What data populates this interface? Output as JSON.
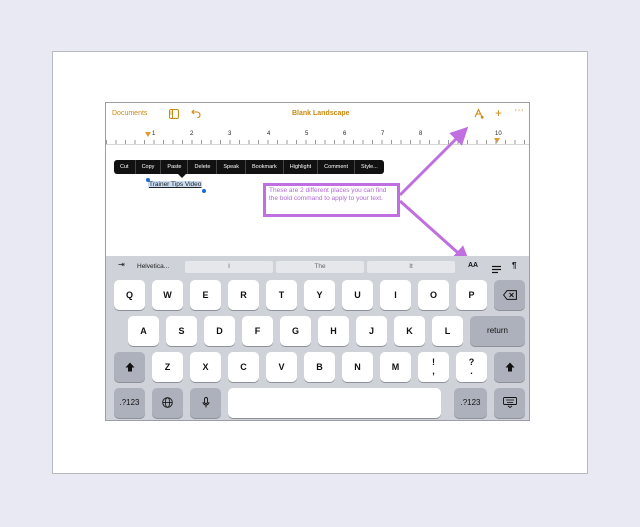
{
  "toolbar": {
    "documents": "Documents",
    "title": "Blank Landscape",
    "more": "⋯"
  },
  "ruler": {
    "labels": [
      "1",
      "2",
      "3",
      "4",
      "5",
      "6",
      "7",
      "8",
      "9",
      "10"
    ]
  },
  "context_menu": [
    "Cut",
    "Copy",
    "Paste",
    "Delete",
    "Speak",
    "Bookmark",
    "Highlight",
    "Comment",
    "Style..."
  ],
  "document": {
    "selected_text": "Trainer Tips Video"
  },
  "annotation": {
    "text": "These are 2 different places you can find the bold command to apply to your text."
  },
  "keyboard": {
    "font_name": "Helvetica...",
    "predictions": [
      "I",
      "The",
      "It"
    ],
    "format_aa": "AA",
    "paragraph": "¶",
    "rows": [
      [
        "Q",
        "W",
        "E",
        "R",
        "T",
        "Y",
        "U",
        "I",
        "O",
        "P"
      ],
      [
        "A",
        "S",
        "D",
        "F",
        "G",
        "H",
        "J",
        "K",
        "L"
      ],
      [
        "Z",
        "X",
        "C",
        "V",
        "B",
        "N",
        "M",
        "!\n,",
        "?\n."
      ]
    ],
    "return": "return",
    "num1": ".?123",
    "num2": ".?123"
  },
  "colors": {
    "accent": "#c98a13",
    "annotation": "#c06fe0",
    "keyboard_bg": "#cfd2d9"
  }
}
